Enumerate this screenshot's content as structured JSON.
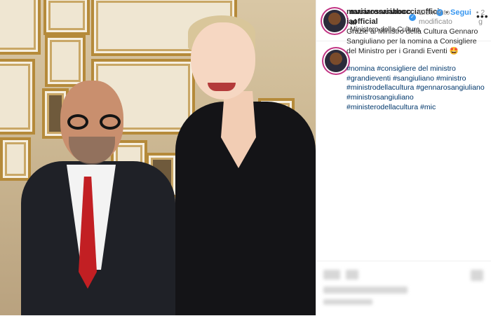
{
  "header": {
    "username": "mariarosariabocciaofficial",
    "verified_mark": "✓",
    "separator": "•",
    "follow_label": "Segui",
    "more_label": "•••",
    "location": "Ministero della Cultura"
  },
  "caption": {
    "username": "mariarosariabocciaofficial",
    "verified_mark": "✓",
    "edited_label": "Elemento modificato",
    "time_label": "• 2 g",
    "text": "Grazie al Ministro della Cultura Gennaro Sangiuliano per la nomina a Consigliere del Ministro per i Grandi Eventi 🤩",
    "hashtags": "#nomina #consigliere del ministro #grandieventi #sangiuliano #ministro #ministrodellacultura #gennarosangiuliano #ministrosangiuliano #ministerodellacultura #mic"
  },
  "colors": {
    "link": "#00376b",
    "follow": "#3897f0",
    "verified": "#3897f0",
    "muted": "#8e8e8e"
  },
  "icons": {
    "verified": "verified-badge-icon",
    "more": "more-options-icon"
  }
}
